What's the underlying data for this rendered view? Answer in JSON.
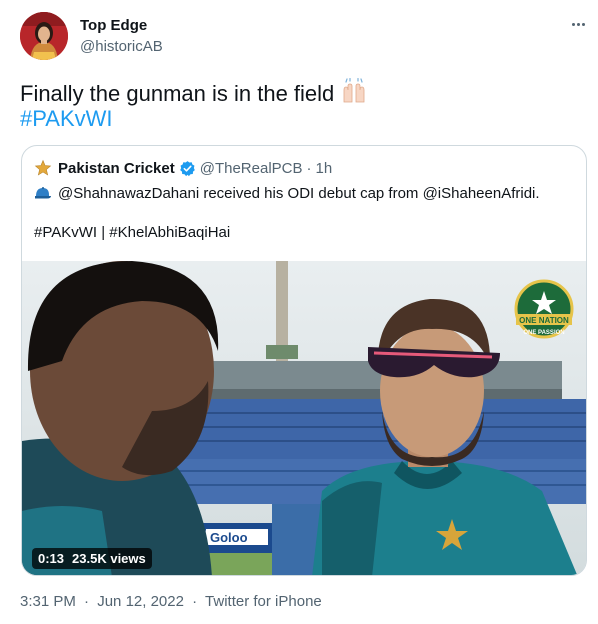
{
  "author": {
    "name": "Top Edge",
    "handle": "@historicAB"
  },
  "tweet": {
    "text": "Finally the gunman is in the field",
    "emoji": "raising-hands",
    "hashtag": "#PAKvWI"
  },
  "quoted": {
    "name": "Pakistan Cricket",
    "handle": "@TheRealPCB",
    "separator": "·",
    "time": "1h",
    "text": "@ShahnawazDahani received his ODI debut cap from @iShaheenAfridi.",
    "tags": "#PAKvWI | #KhelAbhiBaqiHai",
    "video": {
      "duration": "0:13",
      "views": "23.5K views",
      "brand_badge": "ONE NATION",
      "brand_badge_sub": "ONE PASSION"
    }
  },
  "footer": {
    "time": "3:31 PM",
    "date": "Jun 12, 2022",
    "separator": "·",
    "source": "Twitter for iPhone"
  },
  "colors": {
    "link": "#1d9bf0",
    "secondary_text": "#536471",
    "border": "#cfd9de",
    "verified": "#1d9bf0"
  },
  "icons": [
    "more-icon",
    "star-icon",
    "verified-icon",
    "cap-icon",
    "clap-icon"
  ]
}
